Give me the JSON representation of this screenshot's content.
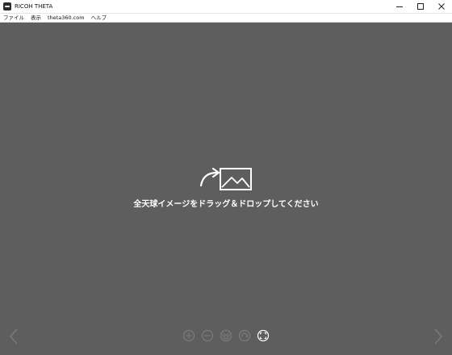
{
  "window": {
    "title": "RICOH THETA",
    "minimize_icon": "minimize-icon",
    "maximize_icon": "maximize-icon",
    "close_icon": "close-icon"
  },
  "menu": {
    "items": [
      {
        "label": "ファイル"
      },
      {
        "label": "表示"
      },
      {
        "label": "theta360.com"
      },
      {
        "label": "ヘルプ"
      }
    ]
  },
  "viewer": {
    "drop_message": "全天球イメージをドラッグ＆ドロップしてください",
    "drop_icon": "import-image-icon",
    "background_color": "#5e5e5e"
  },
  "navigation": {
    "prev_icon": "chevron-left-icon",
    "next_icon": "chevron-right-icon"
  },
  "toolbar": {
    "buttons": [
      {
        "icon": "zoom-in-icon",
        "enabled": false
      },
      {
        "icon": "zoom-out-icon",
        "enabled": false
      },
      {
        "icon": "view-mode-icon",
        "enabled": false
      },
      {
        "icon": "rotate-icon",
        "enabled": false
      },
      {
        "icon": "fullscreen-icon",
        "enabled": true
      }
    ]
  }
}
